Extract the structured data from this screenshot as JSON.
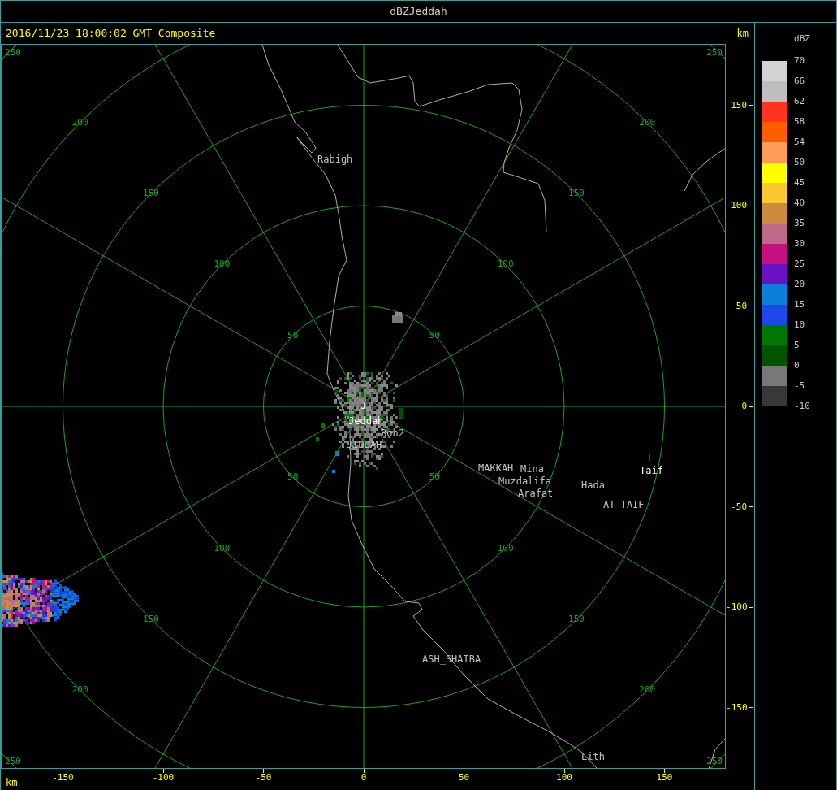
{
  "window": {
    "title": "dBZJeddah"
  },
  "header": {
    "timestamp": "2016/11/23 18:00:02 GMT Composite",
    "unit": "km"
  },
  "rings": [
    {
      "labels": [
        "50",
        "50",
        "50",
        "50"
      ]
    },
    {
      "labels": [
        "100",
        "100",
        "100",
        "100"
      ]
    },
    {
      "labels": [
        "150",
        "150",
        "150",
        "150"
      ]
    },
    {
      "labels": [
        "200",
        "200",
        "200",
        "200"
      ]
    },
    {
      "labels": [
        "250",
        "250",
        "250",
        "250"
      ]
    }
  ],
  "places": [
    {
      "name": "Rabigh",
      "color": "#c0c0c0"
    },
    {
      "name": "J",
      "color": "#ffffff"
    },
    {
      "name": "Jeddah",
      "color": "#ffffff"
    },
    {
      "name": "Boh2",
      "color": "#c0c0c0"
    },
    {
      "name": "JIDDAH",
      "color": "#c0c0c0"
    },
    {
      "name": "MAKKAH",
      "color": "#c0c0c0"
    },
    {
      "name": "Mina",
      "color": "#c0c0c0"
    },
    {
      "name": "Muzdalifa",
      "color": "#c0c0c0"
    },
    {
      "name": "Arafat",
      "color": "#c0c0c0"
    },
    {
      "name": "Hada",
      "color": "#c0c0c0"
    },
    {
      "name": "T",
      "color": "#ffffff"
    },
    {
      "name": "Taif",
      "color": "#ffffff"
    },
    {
      "name": "AT_TAIF",
      "color": "#c0c0c0"
    },
    {
      "name": "ASH_SHAIBA",
      "color": "#c0c0c0"
    },
    {
      "name": "Lith",
      "color": "#c0c0c0"
    }
  ],
  "y_axis": {
    "ticks": [
      "150",
      "100",
      "50",
      "0",
      "-50",
      "-100",
      "-150"
    ]
  },
  "x_axis": {
    "unit": "km",
    "ticks": [
      "-150",
      "-100",
      "-50",
      "0",
      "50",
      "100",
      "150"
    ]
  },
  "legend": {
    "title": "dBZ",
    "labels": [
      "70",
      "66",
      "62",
      "58",
      "54",
      "50",
      "45",
      "40",
      "35",
      "30",
      "25",
      "20",
      "15",
      "10",
      "5",
      "0",
      "-5",
      "-10"
    ],
    "bins": [
      {
        "color": "#d3d3d3"
      },
      {
        "color": "#bebebe"
      },
      {
        "color": "#ff3420"
      },
      {
        "color": "#ff5e00"
      },
      {
        "color": "#ff9c5a"
      },
      {
        "color": "#ffff00"
      },
      {
        "color": "#fbc731"
      },
      {
        "color": "#cd8b40"
      },
      {
        "color": "#bd6a88"
      },
      {
        "color": "#c5127e"
      },
      {
        "color": "#6a11c4"
      },
      {
        "color": "#0a80d8"
      },
      {
        "color": "#1e48ea"
      },
      {
        "color": "#007800"
      },
      {
        "color": "#005400"
      },
      {
        "color": "#787878"
      },
      {
        "color": "#383838"
      }
    ]
  }
}
